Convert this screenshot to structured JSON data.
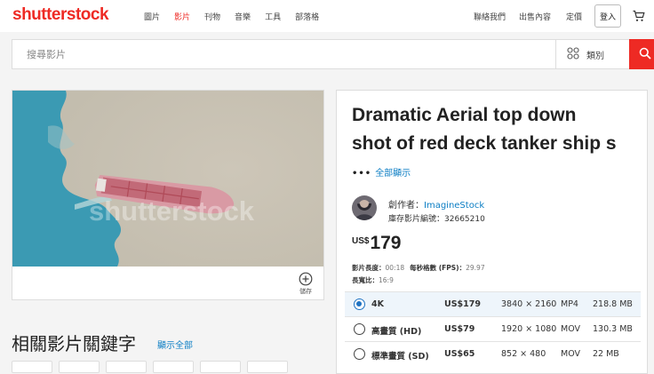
{
  "header": {
    "logo_part1": "shutterst",
    "logo_part2": "ck",
    "nav": [
      "圖片",
      "影片",
      "刊物",
      "音樂",
      "工具",
      "部落格"
    ],
    "nav_active_index": 1,
    "right_links": [
      "聯絡我們",
      "出售內容",
      "定價"
    ],
    "login": "登入"
  },
  "search": {
    "placeholder": "搜尋影片",
    "category_label": "類別"
  },
  "media": {
    "watermark": "shutterstock",
    "save_label": "儲存"
  },
  "keywords": {
    "heading": "相關影片關鍵字",
    "show_all": "顯示全部"
  },
  "details": {
    "title_line1": "Dramatic Aerial top down",
    "title_line2": "shot of red deck tanker ship s",
    "more_dots": "•••",
    "show_all": "全部顯示",
    "author_label": "創作者：",
    "author_name": "ImagineStock",
    "stock_label": "庫存影片編號：",
    "stock_id": "32665210",
    "currency": "US$",
    "price": "179",
    "length_label": "影片長度：",
    "length_value": "00:18",
    "fps_label": "每秒格數 (FPS)：",
    "fps_value": "29.97",
    "ratio_label": "長寬比：",
    "ratio_value": "16:9"
  },
  "options": [
    {
      "name": "4K",
      "price": "US$179",
      "resolution": "3840 × 2160",
      "format": "MP4",
      "size": "218.8 MB",
      "selected": true
    },
    {
      "name": "高畫質 (HD)",
      "price": "US$79",
      "resolution": "1920 × 1080",
      "format": "MOV",
      "size": "130.3 MB",
      "selected": false
    },
    {
      "name": "標準畫質 (SD)",
      "price": "US$65",
      "resolution": "852 × 480",
      "format": "MOV",
      "size": "22 MB",
      "selected": false
    }
  ],
  "colors": {
    "brand_red": "#ee2a24",
    "link_blue": "#0c7ec4",
    "radio_blue": "#1f73c3",
    "sea": "#3b9ab3",
    "foam": "#c9c2b3",
    "deck_red": "#c26a78"
  }
}
